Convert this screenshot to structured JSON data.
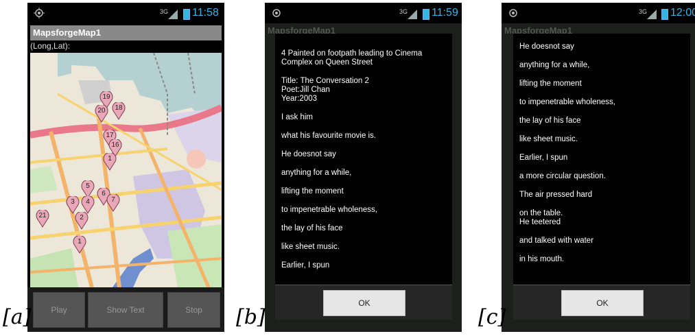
{
  "captions": {
    "a": "[a]",
    "b": "[b]",
    "c": "[c]"
  },
  "status": {
    "signal": "3G",
    "time_a": "11:58",
    "time_b": "11:59",
    "time_c": "12:00",
    "accent": "#33b5e5"
  },
  "app": {
    "title": "MapsforgeMap1",
    "coord_label": "(Long,Lat):"
  },
  "map": {
    "markers": [
      "19",
      "18",
      "20",
      "17",
      "16",
      "1",
      "5",
      "6",
      "4",
      "3",
      "7",
      "2",
      "21",
      "1"
    ]
  },
  "buttons": {
    "play": "Play",
    "show_text": "Show Text",
    "stop": "Stop"
  },
  "dialog_b": {
    "lines": [
      [
        "4 Painted on footpath leading to Cinema",
        "Complex on Queen Street"
      ],
      [
        "Title: The Conversation 2",
        "Poet:Jill Chan",
        "Year:2003"
      ],
      [
        "I ask him"
      ],
      [
        "what his favourite movie is."
      ],
      [
        "He doesnot say"
      ],
      [
        "anything for a while,"
      ],
      [
        "lifting the moment"
      ],
      [
        "to impenetrable wholeness,"
      ],
      [
        "the lay of his face"
      ],
      [
        "like sheet music."
      ],
      [
        "Earlier, I spun"
      ]
    ],
    "ok": "OK"
  },
  "dialog_c": {
    "lines": [
      [
        "He doesnot say"
      ],
      [
        "anything for a while,"
      ],
      [
        "lifting the moment"
      ],
      [
        "to impenetrable wholeness,"
      ],
      [
        "the lay of his face"
      ],
      [
        "like sheet music."
      ],
      [
        "Earlier, I spun"
      ],
      [
        "a more circular question."
      ],
      [
        "The air pressed hard"
      ],
      [
        "on the table.",
        "He teetered"
      ],
      [
        "and talked with water"
      ],
      [
        "in his mouth."
      ]
    ],
    "ok": "OK"
  }
}
